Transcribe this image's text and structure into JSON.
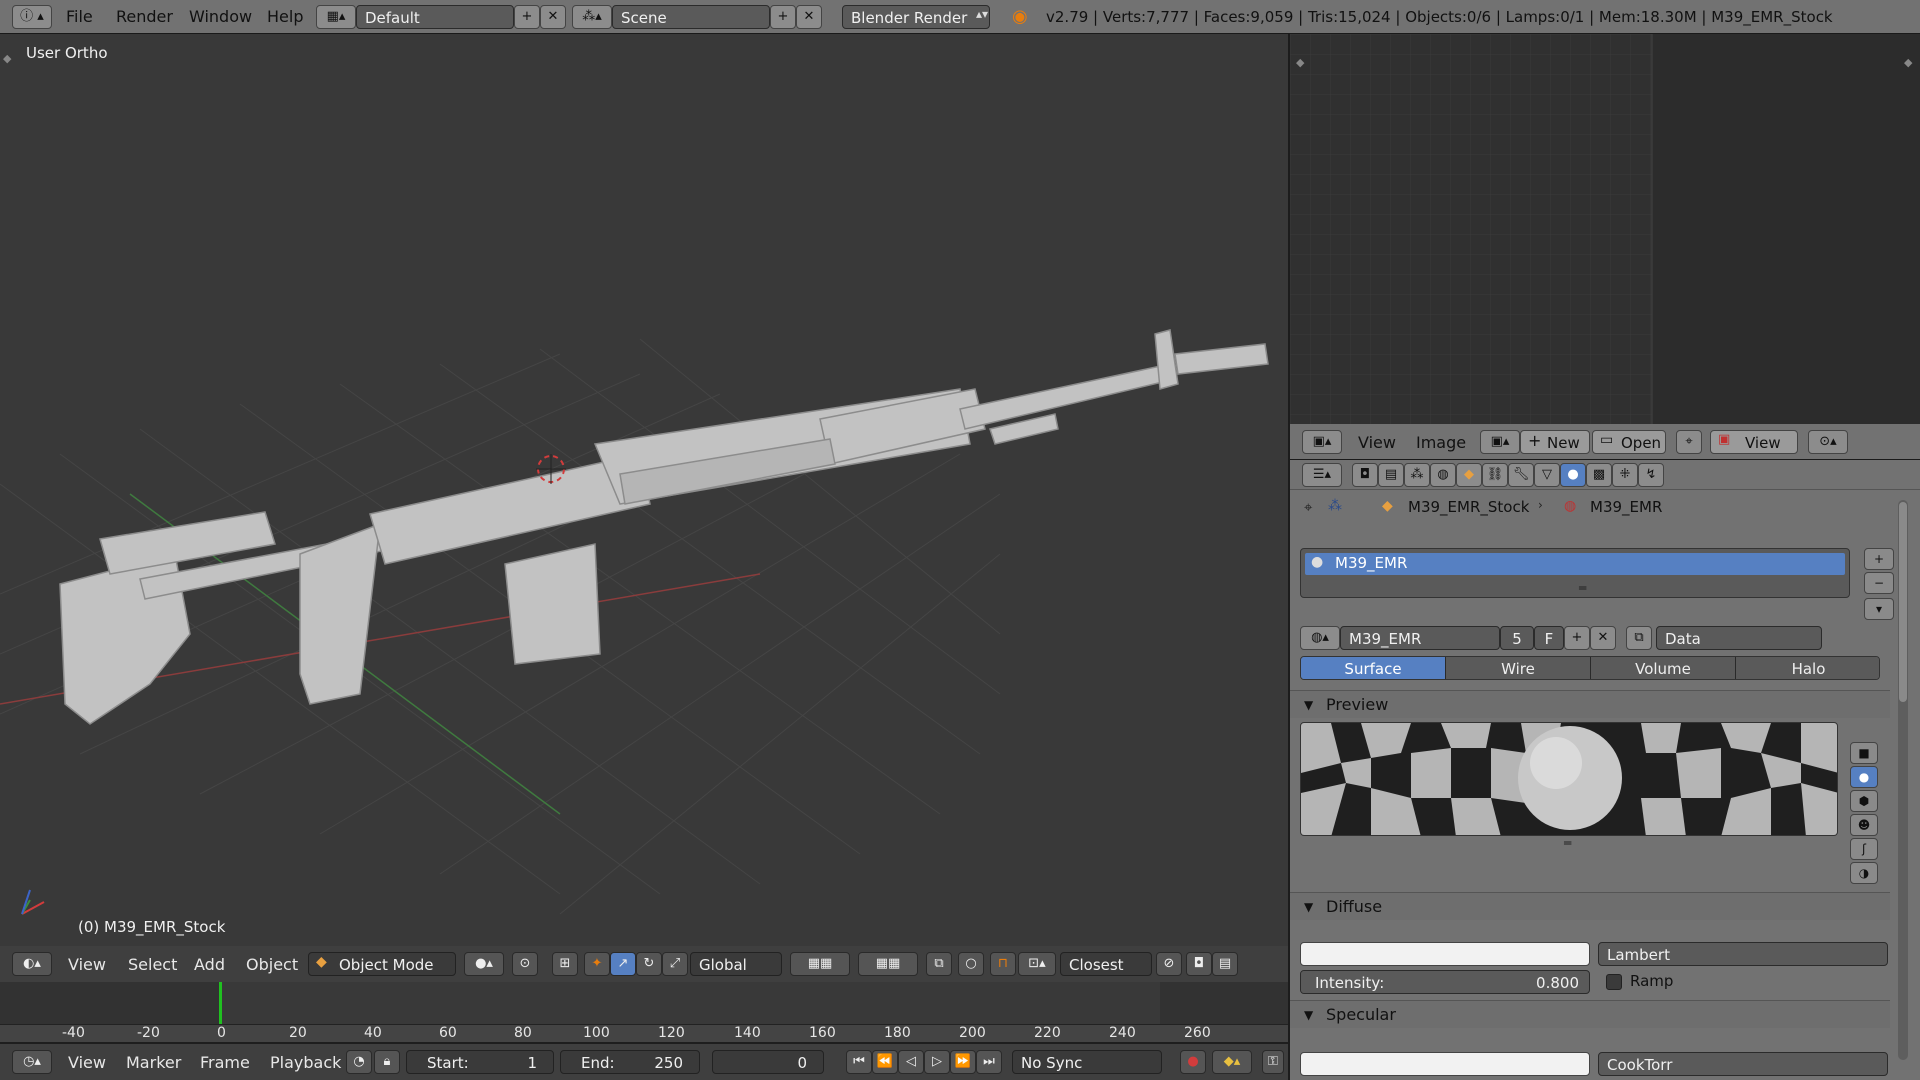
{
  "topbar": {
    "menus": [
      "File",
      "Render",
      "Window",
      "Help"
    ],
    "layout": "Default",
    "scene": "Scene",
    "engine": "Blender Render",
    "stats": "v2.79 | Verts:7,777 | Faces:9,059 | Tris:15,024 | Objects:0/6 | Lamps:0/1 | Mem:18.30M | M39_EMR_Stock"
  },
  "viewport": {
    "view_label": "User Ortho",
    "object_label": "(0) M39_EMR_Stock",
    "menus": [
      "View",
      "Select",
      "Add",
      "Object"
    ],
    "mode": "Object Mode",
    "orientation": "Global",
    "snap_element": "Closest"
  },
  "timeline": {
    "ticks": [
      "-40",
      "-20",
      "0",
      "20",
      "40",
      "60",
      "80",
      "100",
      "120",
      "140",
      "160",
      "180",
      "200",
      "220",
      "240",
      "260"
    ],
    "menus": [
      "View",
      "Marker",
      "Frame",
      "Playback"
    ],
    "start_label": "Start:",
    "start_value": "1",
    "end_label": "End:",
    "end_value": "250",
    "current_frame": "0",
    "sync": "No Sync"
  },
  "image_editor": {
    "menus": [
      "View",
      "Image"
    ],
    "new_label": "New",
    "open_label": "Open",
    "view_label": "View"
  },
  "properties": {
    "breadcrumb_object": "M39_EMR_Stock",
    "breadcrumb_material": "M39_EMR",
    "slot_name": "M39_EMR",
    "material_name": "M39_EMR",
    "users": "5",
    "fake_user": "F",
    "link": "Data",
    "tabs": [
      "Surface",
      "Wire",
      "Volume",
      "Halo"
    ],
    "active_tab": "Surface",
    "preview_label": "Preview",
    "diffuse_label": "Diffuse",
    "diffuse_shader": "Lambert",
    "intensity_label": "Intensity:",
    "intensity_value": "0.800",
    "ramp_label": "Ramp",
    "specular_label": "Specular",
    "specular_shader": "CookTorr"
  },
  "colors": {
    "accent": "#5680c2",
    "header": "#727272",
    "viewport_bg": "#393939"
  }
}
